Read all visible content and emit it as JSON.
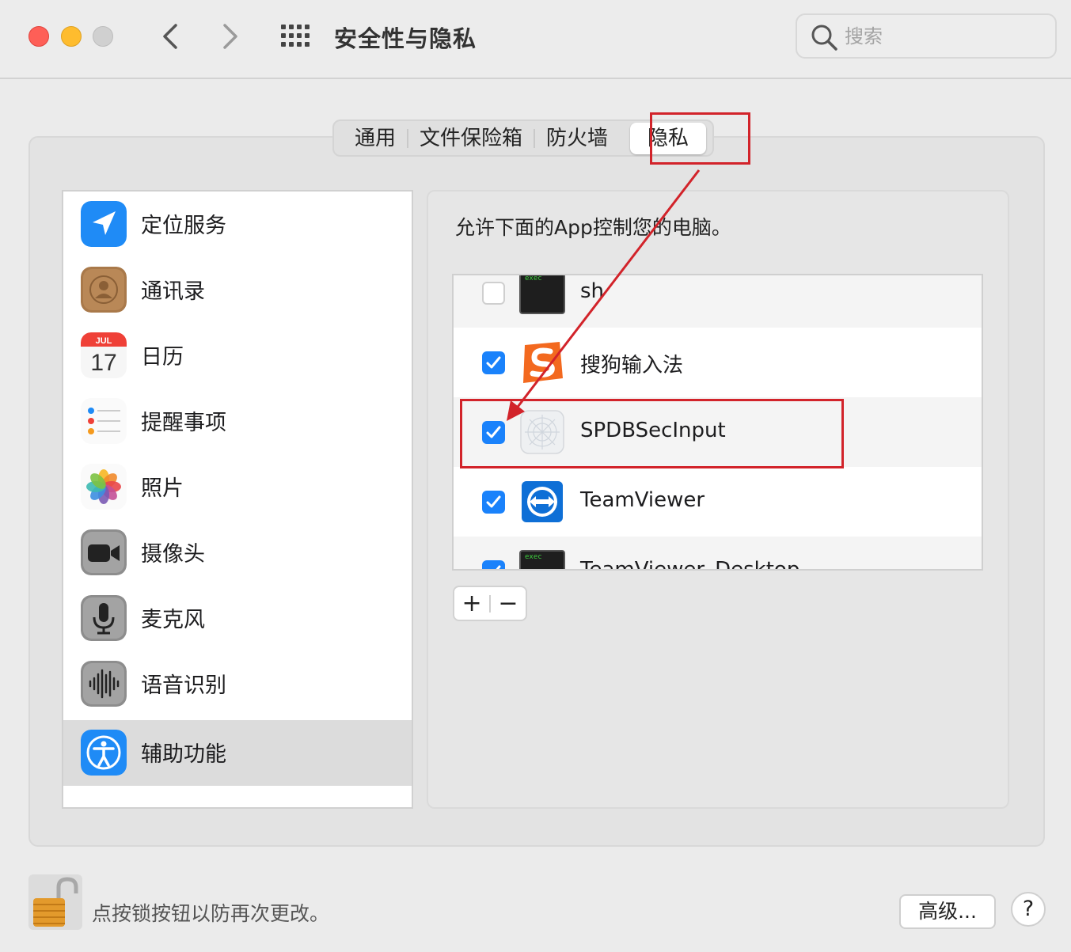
{
  "window": {
    "title": "安全性与隐私",
    "search_placeholder": "搜索"
  },
  "tabs": [
    {
      "label": "通用"
    },
    {
      "label": "文件保险箱"
    },
    {
      "label": "防火墙"
    },
    {
      "label": "隐私",
      "active": true
    }
  ],
  "sidebar": {
    "items": [
      {
        "label": "定位服务",
        "icon": "location-icon"
      },
      {
        "label": "通讯录",
        "icon": "contacts-icon"
      },
      {
        "label": "日历",
        "icon": "calendar-icon",
        "icon_month": "JUL",
        "icon_day": "17"
      },
      {
        "label": "提醒事项",
        "icon": "reminders-icon"
      },
      {
        "label": "照片",
        "icon": "photos-icon"
      },
      {
        "label": "摄像头",
        "icon": "camera-icon"
      },
      {
        "label": "麦克风",
        "icon": "microphone-icon"
      },
      {
        "label": "语音识别",
        "icon": "speech-recognition-icon"
      },
      {
        "label": "辅助功能",
        "icon": "accessibility-icon",
        "selected": true
      }
    ]
  },
  "panel": {
    "description": "允许下面的App控制您的电脑。",
    "apps": [
      {
        "name": "sh",
        "checked": false,
        "icon": "exec-terminal-icon",
        "icon_text": "exec"
      },
      {
        "name": "搜狗输入法",
        "checked": true,
        "icon": "sogou-input-icon"
      },
      {
        "name": "SPDBSecInput",
        "checked": true,
        "icon": "spdb-secinput-icon"
      },
      {
        "name": "TeamViewer",
        "checked": true,
        "icon": "teamviewer-icon"
      },
      {
        "name": "TeamViewer_Desktop",
        "checked": true,
        "icon": "exec-terminal-icon",
        "icon_text": "exec"
      }
    ],
    "add_label": "+",
    "remove_label": "−"
  },
  "footer": {
    "lock_text": "点按锁按钮以防再次更改。",
    "advanced_label": "高级...",
    "help_label": "?"
  },
  "annotation_color": "#d2232a",
  "accent_color": "#1a82fb"
}
